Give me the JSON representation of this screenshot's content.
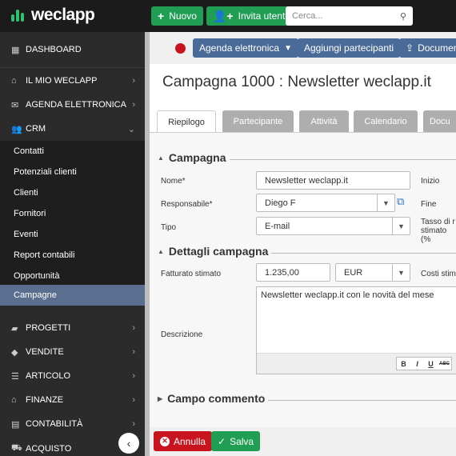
{
  "brand": {
    "name": "weclapp",
    "green": "#1f9e54",
    "blue": "#4a6a98",
    "red": "#c8141e",
    "sidebar_bg": "#2b2b2b"
  },
  "topbar": {
    "new_label": "Nuovo",
    "invite_label": "Invita utente",
    "search_placeholder": "Cerca..."
  },
  "sidebar": {
    "items": [
      {
        "label": "DASHBOARD",
        "icon": "grid-icon"
      },
      {
        "label": "IL MIO WECLAPP",
        "icon": "home-icon"
      },
      {
        "label": "AGENDA ELETTRONICA",
        "icon": "envelope-icon"
      },
      {
        "label": "CRM",
        "icon": "users-icon"
      },
      {
        "label": "PROGETTI",
        "icon": "briefcase-icon"
      },
      {
        "label": "VENDITE",
        "icon": "tag-icon"
      },
      {
        "label": "ARTICOLO",
        "icon": "list-icon"
      },
      {
        "label": "FINANZE",
        "icon": "bank-icon"
      },
      {
        "label": "CONTABILITÀ",
        "icon": "calculator-icon"
      },
      {
        "label": "ACQUISTO",
        "icon": "cart-icon"
      }
    ],
    "crm_sub": [
      "Contatti",
      "Potenziali clienti",
      "Clienti",
      "Fornitori",
      "Eventi",
      "Report contabili",
      "Opportunità",
      "Campagne"
    ]
  },
  "actionbar": {
    "agenda_label": "Agenda elettronica",
    "add_participants_label": "Aggiungi partecipanti",
    "document_label": "Documen"
  },
  "page": {
    "title": "Campagna 1000 : Newsletter weclapp.it"
  },
  "tabs": [
    "Riepilogo",
    "Partecipante",
    "Attività",
    "Calendario",
    "Docu"
  ],
  "campaign": {
    "section_title": "Campagna",
    "name_label": "Nome*",
    "name_value": "Newsletter weclapp.it",
    "start_label": "Inizio",
    "responsible_label": "Responsabile*",
    "responsible_value": "Diego F",
    "end_label": "Fine",
    "type_label": "Tipo",
    "type_value": "E-mail",
    "rate_label_1": "Tasso di r",
    "rate_label_2": "stimato (%"
  },
  "details": {
    "section_title": "Dettagli campagna",
    "revenue_label": "Fatturato stimato",
    "revenue_value": "1.235,00",
    "currency_value": "EUR",
    "cost_label": "Costi stim",
    "description_label": "Descrizione",
    "description_value": "Newsletter weclapp.it con le novità del mese",
    "rt_bold": "B",
    "rt_italic": "I",
    "rt_underline": "U",
    "rt_strike": "ABC"
  },
  "comment": {
    "section_title": "Campo commento"
  },
  "footer": {
    "cancel_label": "Annulla",
    "save_label": "Salva"
  }
}
